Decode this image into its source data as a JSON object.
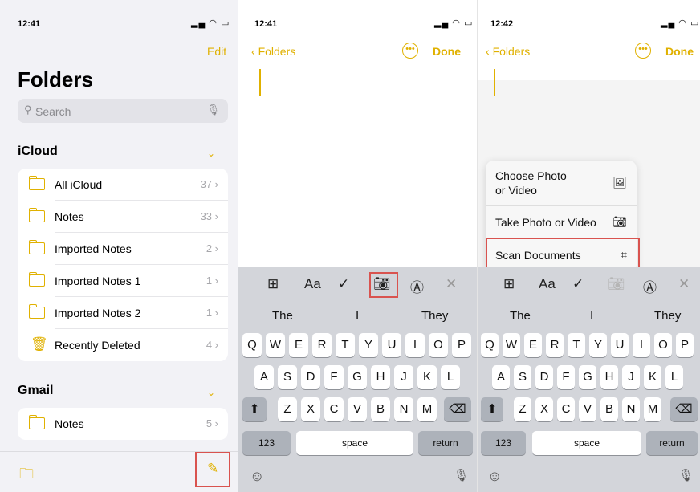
{
  "panel1": {
    "time": "12:41",
    "edit": "Edit",
    "title": "Folders",
    "search_placeholder": "Search",
    "icloud": {
      "header": "iCloud",
      "items": [
        {
          "label": "All iCloud",
          "count": "37"
        },
        {
          "label": "Notes",
          "count": "33"
        },
        {
          "label": "Imported Notes",
          "count": "2"
        },
        {
          "label": "Imported Notes 1",
          "count": "1"
        },
        {
          "label": "Imported Notes 2",
          "count": "1"
        },
        {
          "label": "Recently Deleted",
          "count": "4"
        }
      ]
    },
    "gmail": {
      "header": "Gmail",
      "items": [
        {
          "label": "Notes",
          "count": "5"
        }
      ]
    }
  },
  "panel2": {
    "time": "12:41",
    "back": "Folders",
    "done": "Done",
    "suggestions": [
      "The",
      "I",
      "They"
    ],
    "keys": {
      "row1": [
        "Q",
        "W",
        "E",
        "R",
        "T",
        "Y",
        "U",
        "I",
        "O",
        "P"
      ],
      "row2": [
        "A",
        "S",
        "D",
        "F",
        "G",
        "H",
        "J",
        "K",
        "L"
      ],
      "row3": [
        "Z",
        "X",
        "C",
        "V",
        "B",
        "N",
        "M"
      ],
      "num": "123",
      "space": "space",
      "return": "return"
    }
  },
  "panel3": {
    "time": "12:42",
    "back": "Folders",
    "done": "Done",
    "menu": {
      "choose_photo": "Choose Photo\nor Video",
      "take_photo": "Take Photo or Video",
      "scan": "Scan Documents"
    },
    "suggestions": [
      "The",
      "I",
      "They"
    ]
  },
  "toolbar": {
    "format_label": "Aa"
  },
  "colors": {
    "accent": "#e0b100",
    "highlight": "#d9534f",
    "keyboard": "#d3d5da"
  },
  "icons": [
    "folder-icon",
    "trash-icon",
    "search-icon",
    "mic-icon",
    "new-folder-icon",
    "compose-icon",
    "table-icon",
    "checklist-icon",
    "camera-icon",
    "markup-icon",
    "close-icon",
    "emoji-icon",
    "scan-icon",
    "photo-icon",
    "more-icon",
    "shift-icon",
    "delete-icon"
  ]
}
